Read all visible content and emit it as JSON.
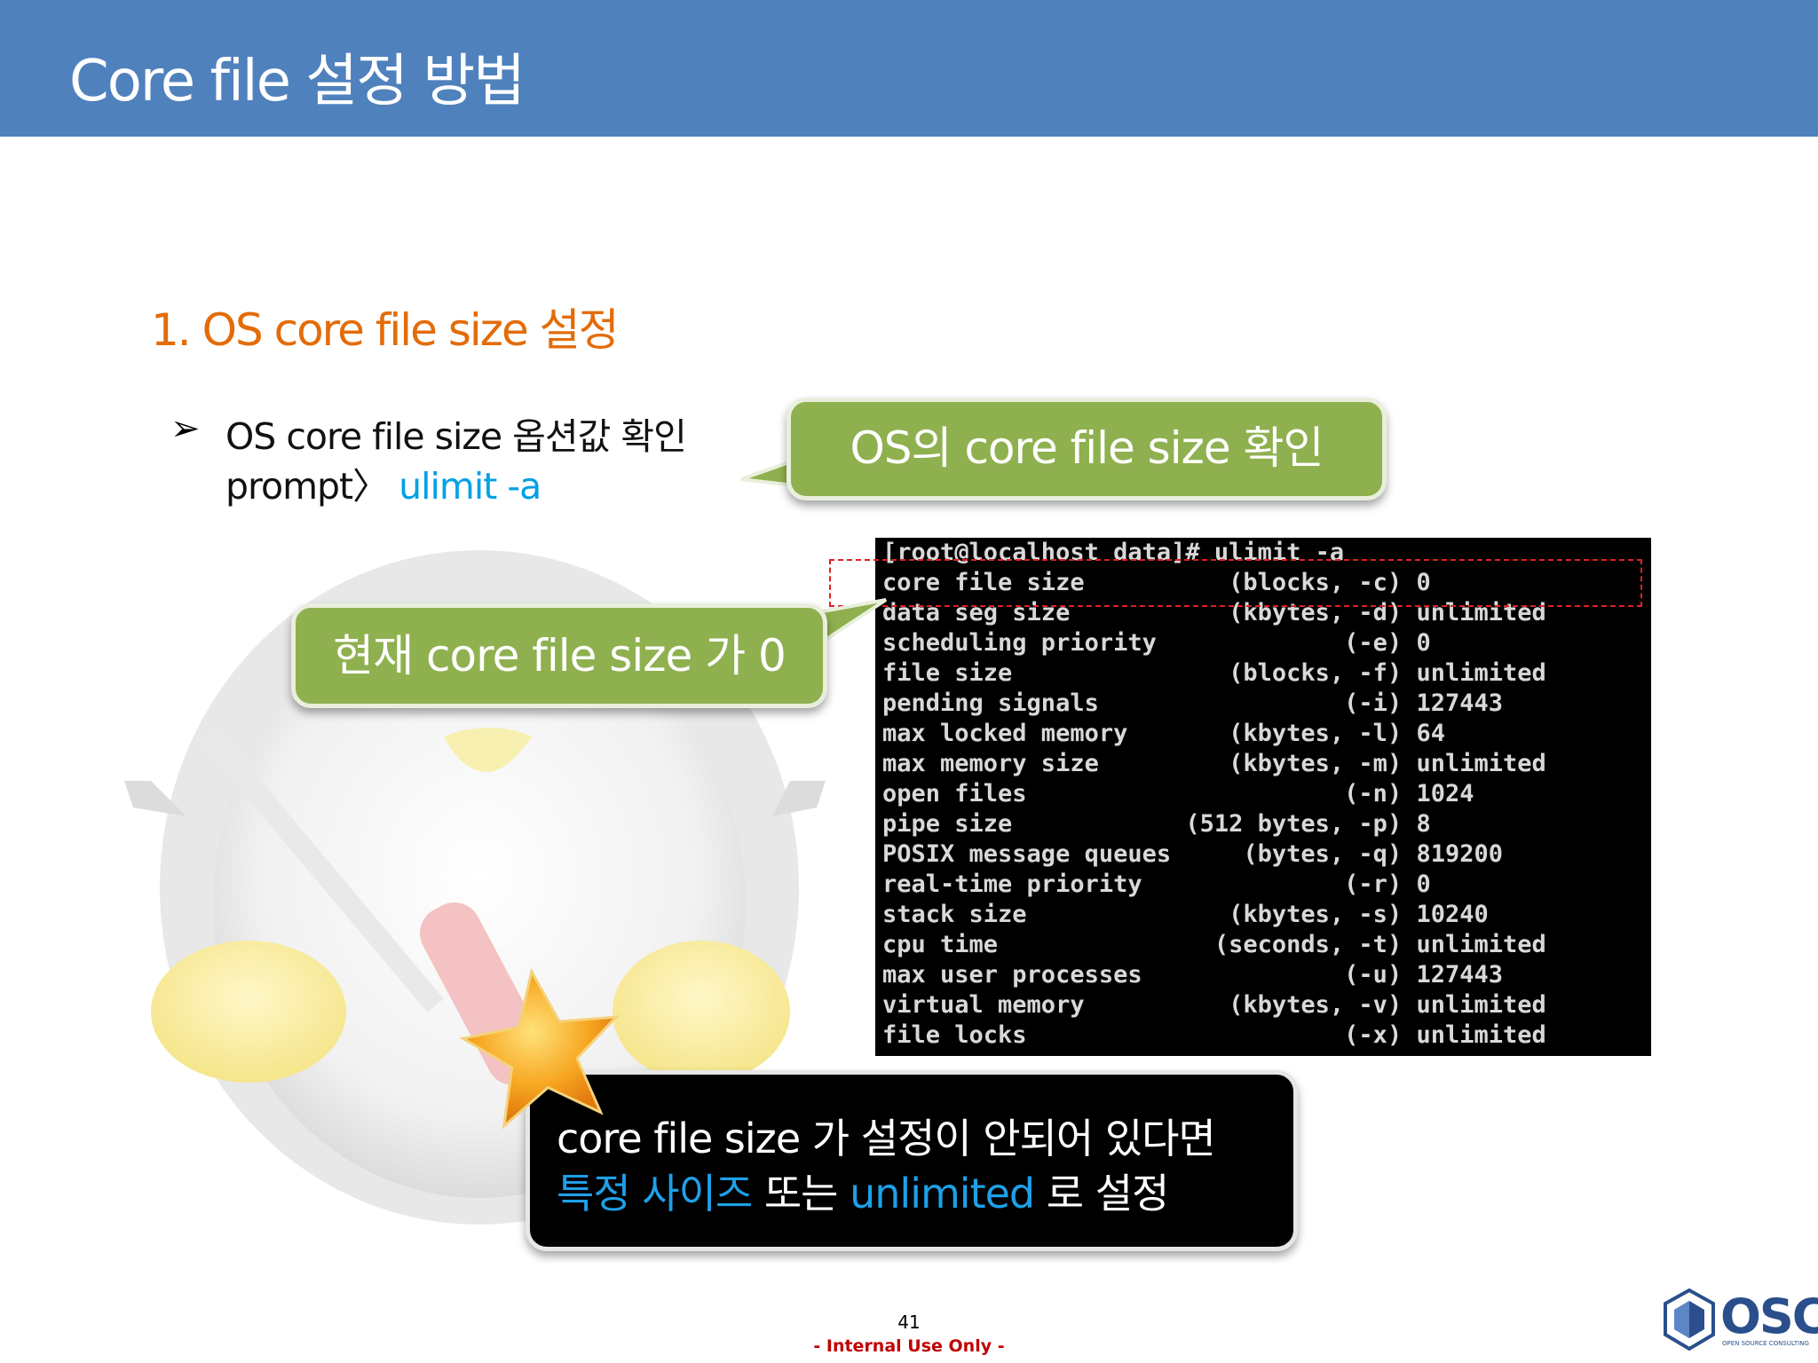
{
  "header": {
    "title": "Core file 설정 방법"
  },
  "section": {
    "title": "1. OS core file size 설정"
  },
  "bullet": {
    "line1": "OS core file size 옵션값 확인",
    "prompt": "prompt〉",
    "command": "ulimit -a"
  },
  "callouts": {
    "top": "OS의 core file size 확인",
    "middle": "현재 core file size 가 0",
    "bottom": {
      "line1": "core file size 가 설정이 안되어 있다면",
      "line2_blue1": "특정 사이즈",
      "line2_mid": " 또는 ",
      "line2_blue2": "unlimited",
      "line2_end": " 로 설정"
    }
  },
  "terminal": {
    "lines": [
      "[root@localhost data]# ulimit -a",
      "core file size          (blocks, -c) 0",
      "data seg size           (kbytes, -d) unlimited",
      "scheduling priority             (-e) 0",
      "file size               (blocks, -f) unlimited",
      "pending signals                 (-i) 127443",
      "max locked memory       (kbytes, -l) 64",
      "max memory size         (kbytes, -m) unlimited",
      "open files                      (-n) 1024",
      "pipe size            (512 bytes, -p) 8",
      "POSIX message queues     (bytes, -q) 819200",
      "real-time priority              (-r) 0",
      "stack size              (kbytes, -s) 10240",
      "cpu time               (seconds, -t) unlimited",
      "max user processes              (-u) 127443",
      "virtual memory          (kbytes, -v) unlimited",
      "file locks                      (-x) unlimited"
    ]
  },
  "footer": {
    "page_number": "41",
    "note": "- Internal Use Only -",
    "logo_text": "OSC",
    "logo_sub": "OPEN SOURCE CONSULTING"
  },
  "colors": {
    "header": "#4f81bd",
    "section_title": "#e36c09",
    "command": "#00a0e6",
    "callout_green": "#8fb04f",
    "highlight": "#1ea0e8",
    "footer_note": "#c00000"
  }
}
